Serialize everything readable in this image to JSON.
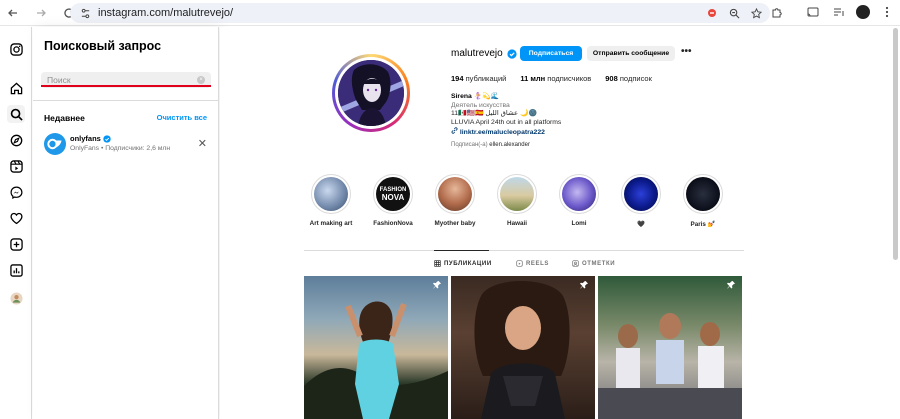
{
  "browser": {
    "url": "instagram.com/malutrevejo/"
  },
  "search_panel": {
    "title": "Поисковый запрос",
    "placeholder": "Поиск",
    "recent_label": "Недавнее",
    "clear_all": "Очистить все",
    "recent_items": [
      {
        "name": "onlyfans",
        "subtitle": "OnlyFans • Подписчики: 2,6 млн",
        "verified": true
      }
    ]
  },
  "profile": {
    "username": "malutrevejo",
    "verified": true,
    "subscribe_label": "Подписаться",
    "message_label": "Отправить сообщение",
    "more_label": "•••",
    "stats": {
      "posts_value": "194",
      "posts_label": "публикаций",
      "followers_value": "11 млн",
      "followers_label": "подписчиков",
      "following_value": "908",
      "following_label": "подписок"
    },
    "bio": {
      "name": "Sirena 🧜‍♀️💫🌊",
      "category": "Деятель искусства",
      "line1": "11🇲🇽🇺🇸🇪🇸 ‫عشاق الليل‬ 🌙🌚",
      "line2": "LLUVIA April 24th out in all platforms",
      "link": "linktr.ee/malucleopatra222"
    },
    "followed_by_prefix": "Подписан(-а)",
    "followed_by_user": "ellen.alexander"
  },
  "highlights": [
    {
      "label": "Art making art"
    },
    {
      "label": "FashionNova"
    },
    {
      "label": "Myother baby"
    },
    {
      "label": "Hawaii"
    },
    {
      "label": "Lomi"
    },
    {
      "label": "🖤"
    },
    {
      "label": "Paris 💅"
    }
  ],
  "tabs": [
    {
      "label": "ПУБЛИКАЦИИ",
      "active": true
    },
    {
      "label": "REELS",
      "active": false
    },
    {
      "label": "ОТМЕТКИ",
      "active": false
    }
  ],
  "colors": {
    "accent": "#0095f6",
    "search_underline": "#e0001a"
  }
}
